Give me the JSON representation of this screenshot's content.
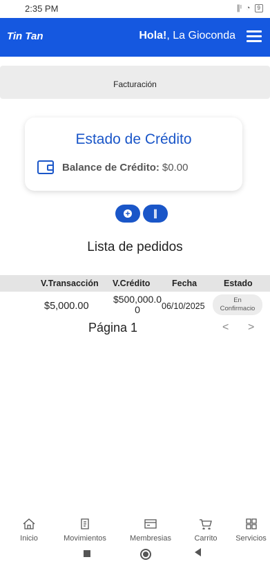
{
  "status_bar": {
    "time": "2:35 PM",
    "signal": "∥ᴵ",
    "wifi": "◔",
    "battery": "9"
  },
  "app_bar": {
    "title": "Tin Tan",
    "greeting_bold": "Hola!",
    "greeting_rest": ", La Gioconda",
    "background": "#1558e0"
  },
  "section_header": {
    "label": "Facturación"
  },
  "credit_card": {
    "title": "Estado de Crédito",
    "balance_label": "Balance de Crédito:",
    "balance_value": "$0.00",
    "accent": "#1a56c8"
  },
  "actions": {
    "add_icon": "+",
    "attach_icon": "∥"
  },
  "orders": {
    "title": "Lista de pedidos",
    "columns": [
      "V.Transacción",
      "V.Crédito",
      "Fecha",
      "Estado"
    ],
    "rows": [
      {
        "transaction_value": "$5,000.00",
        "credit_value_line1": "$500,000.0",
        "credit_value_line2": "0",
        "date": "06/10/2025",
        "status_line1": "En",
        "status_line2": "Confirmacio"
      }
    ]
  },
  "pagination": {
    "label": "Página 1",
    "prev": "<",
    "next": ">"
  },
  "bottom_nav": {
    "items": [
      {
        "label": "Inicio",
        "icon": "home-icon"
      },
      {
        "label": "Movimientos",
        "icon": "receipt-icon"
      },
      {
        "label": "Membresias",
        "icon": "card-icon"
      },
      {
        "label": "Carrito",
        "icon": "cart-icon"
      },
      {
        "label": "Servicios",
        "icon": "grid-icon"
      }
    ]
  }
}
